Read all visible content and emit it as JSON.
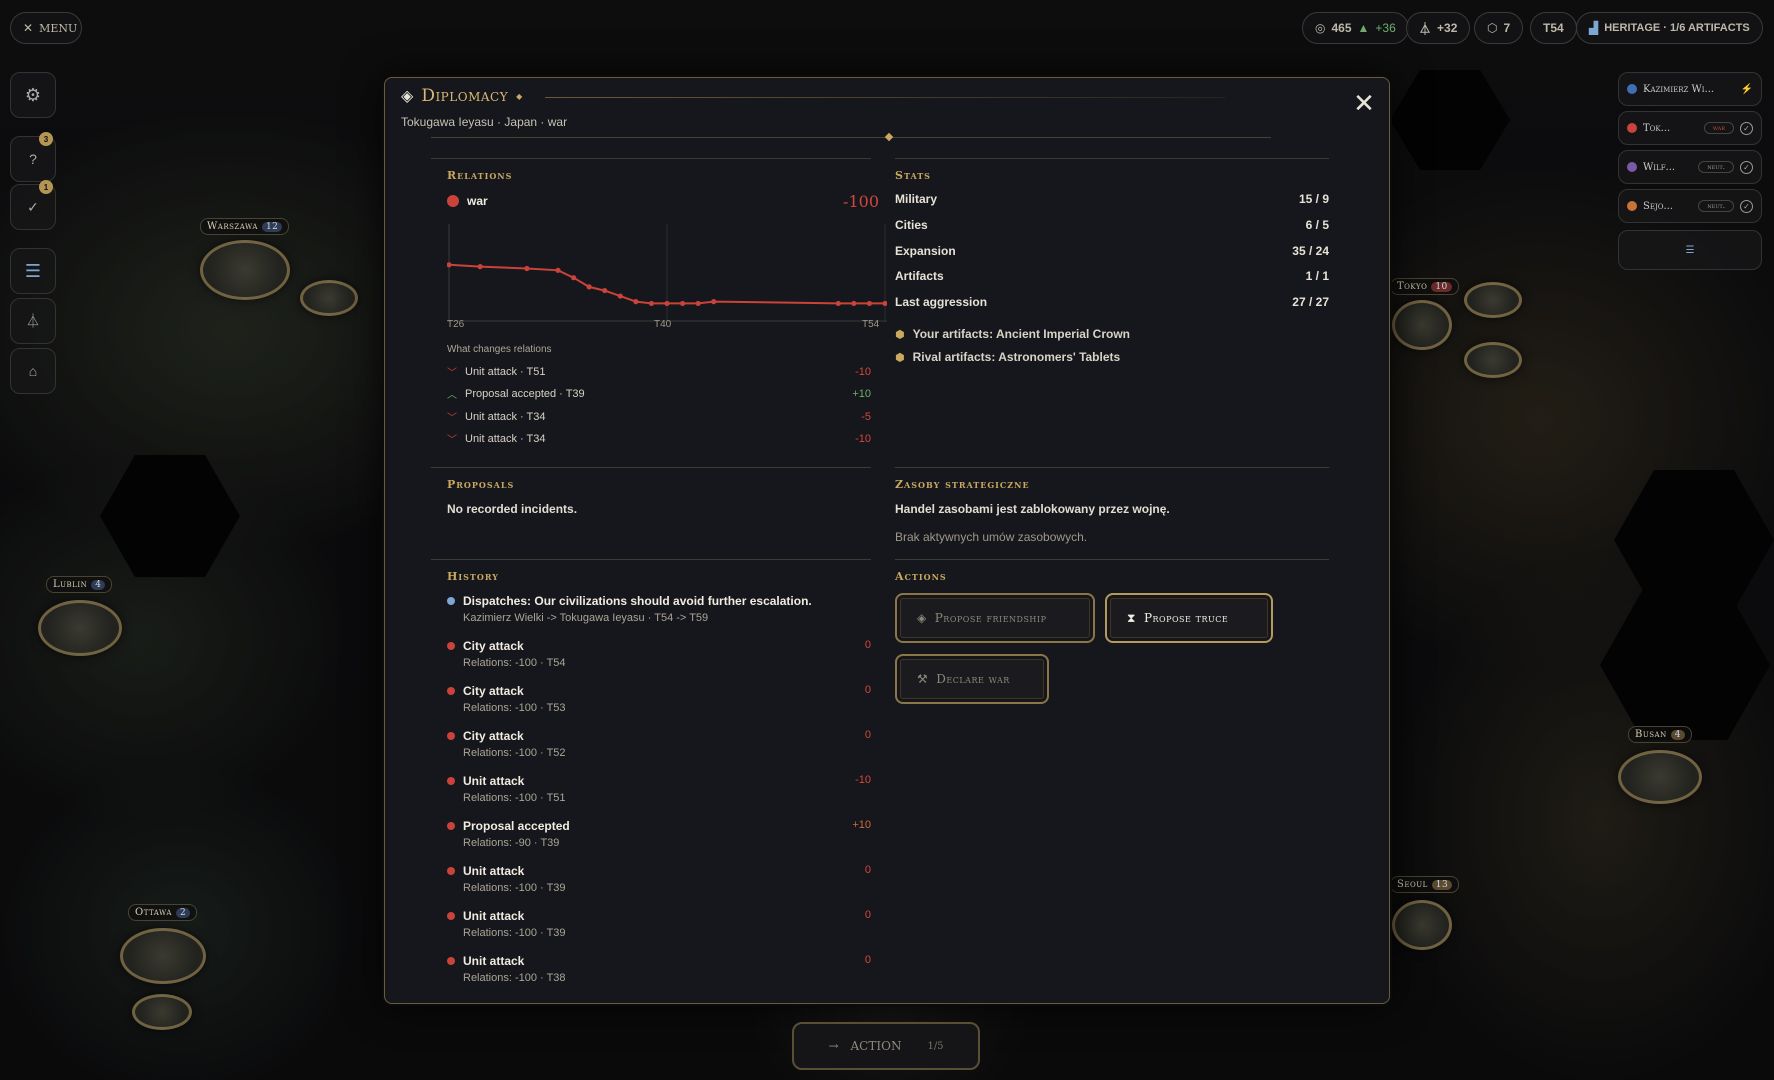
{
  "topbar": {
    "menu_label": "MENU",
    "gold": "465",
    "gold_delta": "+36",
    "science": "+32",
    "production": "7",
    "turn": "T54",
    "heritage": "HERITAGE · 1/6 ARTIFACTS"
  },
  "sidebar": {
    "badge_help": "3",
    "badge_tasks": "1"
  },
  "map": {
    "cities": {
      "warszawa": {
        "name": "Warszawa",
        "num": "12"
      },
      "lublin": {
        "name": "Lublin",
        "num": "4"
      },
      "ottawa": {
        "name": "Ottawa",
        "num": "2"
      },
      "tokyo": {
        "name": "Tokyo",
        "num": "10"
      },
      "busan": {
        "name": "Busan",
        "num": "4"
      },
      "seoul": {
        "name": "Seoul",
        "num": "13"
      }
    }
  },
  "players": [
    {
      "name": "Kazimierz Wi...",
      "color": "#3f6fb0",
      "status": ""
    },
    {
      "name": "Tok...",
      "color": "#c9433a",
      "status": "war"
    },
    {
      "name": "Wilf...",
      "color": "#7a5aa8",
      "status": "neut."
    },
    {
      "name": "Sejo...",
      "color": "#c8733a",
      "status": "neut."
    }
  ],
  "modal": {
    "title": "Diplomacy",
    "subtitle": "Tokugawa Ieyasu · Japan · war",
    "relations": {
      "heading": "Relations",
      "status": "war",
      "value": "-100",
      "axis_ticks": [
        "T26",
        "T40",
        "T54"
      ],
      "changes_heading": "What changes relations",
      "changes": [
        {
          "label": "Unit attack · T51",
          "value": "-10",
          "dir": "down"
        },
        {
          "label": "Proposal accepted · T39",
          "value": "+10",
          "dir": "up"
        },
        {
          "label": "Unit attack · T34",
          "value": "-5",
          "dir": "down"
        },
        {
          "label": "Unit attack · T34",
          "value": "-10",
          "dir": "down"
        }
      ]
    },
    "stats": {
      "heading": "Stats",
      "rows": [
        {
          "label": "Military",
          "value": "15 / 9"
        },
        {
          "label": "Cities",
          "value": "6 / 5"
        },
        {
          "label": "Expansion",
          "value": "35 / 24"
        },
        {
          "label": "Artifacts",
          "value": "1 / 1"
        },
        {
          "label": "Last aggression",
          "value": "27 / 27"
        }
      ],
      "your_artifacts": "Your artifacts: Ancient Imperial Crown",
      "rival_artifacts": "Rival artifacts: Astronomers' Tablets"
    },
    "proposals": {
      "heading": "Proposals",
      "text": "No recorded incidents."
    },
    "resources": {
      "heading": "Zasoby strategiczne",
      "line1": "Handel zasobami jest zablokowany przez wojnę.",
      "line2": "Brak aktywnych umów zasobowych."
    },
    "history": {
      "heading": "History",
      "items": [
        {
          "title": "Dispatches: Our civilizations should avoid further escalation.",
          "sub": "Kazimierz Wielki -> Tokugawa Ieyasu · T54 -> T59",
          "value": "",
          "kind": "dispatch"
        },
        {
          "title": "City attack",
          "sub": "Relations: -100 · T54",
          "value": "0"
        },
        {
          "title": "City attack",
          "sub": "Relations: -100 · T53",
          "value": "0"
        },
        {
          "title": "City attack",
          "sub": "Relations: -100 · T52",
          "value": "0"
        },
        {
          "title": "Unit attack",
          "sub": "Relations: -100 · T51",
          "value": "-10"
        },
        {
          "title": "Proposal accepted",
          "sub": "Relations: -90 · T39",
          "value": "+10"
        },
        {
          "title": "Unit attack",
          "sub": "Relations: -100 · T39",
          "value": "0"
        },
        {
          "title": "Unit attack",
          "sub": "Relations: -100 · T39",
          "value": "0"
        },
        {
          "title": "Unit attack",
          "sub": "Relations: -100 · T38",
          "value": "0"
        }
      ]
    },
    "actions": {
      "heading": "Actions",
      "friendship": "Propose friendship",
      "truce": "Propose truce",
      "war": "Declare war"
    }
  },
  "bottom": {
    "action_label": "ACTION",
    "count": "1/5"
  },
  "chart_data": {
    "type": "line",
    "x_ticks": [
      "T26",
      "T40",
      "T54"
    ],
    "xlim": [
      26,
      54
    ],
    "ylim": [
      -100,
      -50
    ],
    "series": [
      {
        "color": "#c9433a",
        "x": [
          26,
          28,
          31,
          33,
          34,
          35,
          36,
          37,
          38,
          39,
          40,
          41,
          42,
          43,
          51,
          52,
          53,
          54
        ],
        "y": [
          -70,
          -71,
          -72,
          -73,
          -77,
          -82,
          -84,
          -87,
          -90,
          -91,
          -91,
          -91,
          -91,
          -90,
          -91,
          -91,
          -91,
          -91
        ]
      }
    ]
  }
}
